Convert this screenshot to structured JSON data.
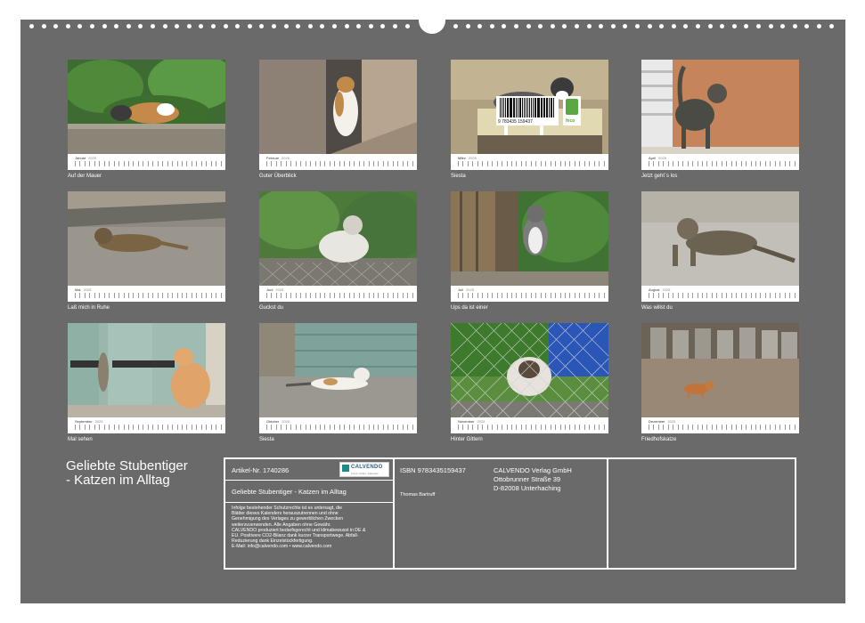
{
  "months": [
    {
      "name": "Januar",
      "year": "2025",
      "caption": "Auf der Mauer"
    },
    {
      "name": "Februar",
      "year": "2025",
      "caption": "Guter Überblick"
    },
    {
      "name": "März",
      "year": "2025",
      "caption": "Siesta"
    },
    {
      "name": "April",
      "year": "2025",
      "caption": "Jetzt geht´s los"
    },
    {
      "name": "Mai",
      "year": "2025",
      "caption": "Laß mich in Ruhe"
    },
    {
      "name": "Juni",
      "year": "2025",
      "caption": "Guckst du"
    },
    {
      "name": "Juli",
      "year": "2025",
      "caption": "Ups da ist einer"
    },
    {
      "name": "August",
      "year": "2025",
      "caption": "Was willst du"
    },
    {
      "name": "September",
      "year": "2025",
      "caption": "Mal sehen"
    },
    {
      "name": "Oktober",
      "year": "2025",
      "caption": "Siesta"
    },
    {
      "name": "November",
      "year": "2025",
      "caption": "Hinter Gittern"
    },
    {
      "name": "Dezember",
      "year": "2025",
      "caption": "Friedhofskatze"
    }
  ],
  "calendar_title_line1": "Geliebte Stubentiger",
  "calendar_title_line2": "- Katzen im Alltag",
  "info": {
    "article": "Artikel-Nr. 1740286",
    "product_title": "Geliebte Stubentiger - Katzen im Alltag",
    "fine_print": "Infolge bestehender Schutzrechte ist es untersagt, die\nBlätter dieses Kalenders herauszutrennen und ohne\nGenehmigung des Verlages zu gewerblichen Zwecken\nweiterzuverwenden. Alle Angaben ohne Gewähr.\nCALVENDO produziert bedarfsgerecht und klimabewusst in DE &\nEU. Positivere CO2-Bilanz dank kurzer Transportwege. Abfall-\nReduzierung dank Einzelstückfertigung.\nE-Mail: info@calvendo.com • www.calvendo.com",
    "isbn": "ISBN 9783435159437",
    "author": "Thomas Bartruff",
    "publisher_name": "CALVENDO Verlag GmbH",
    "publisher_street": "Ottobrunner Straße 39",
    "publisher_city": "D-82008 Unterhaching",
    "barcode_number": "9 783435 159437",
    "logo_text": "CALVENDO",
    "logo_sub": "Kunst. Kultur. Kalender.",
    "feco_label": "feco"
  },
  "colors": {
    "sheet": "#6a6a6a",
    "text": "#ffffff",
    "feco_green": "#5aa843",
    "logo_teal": "#1d8a8a"
  }
}
